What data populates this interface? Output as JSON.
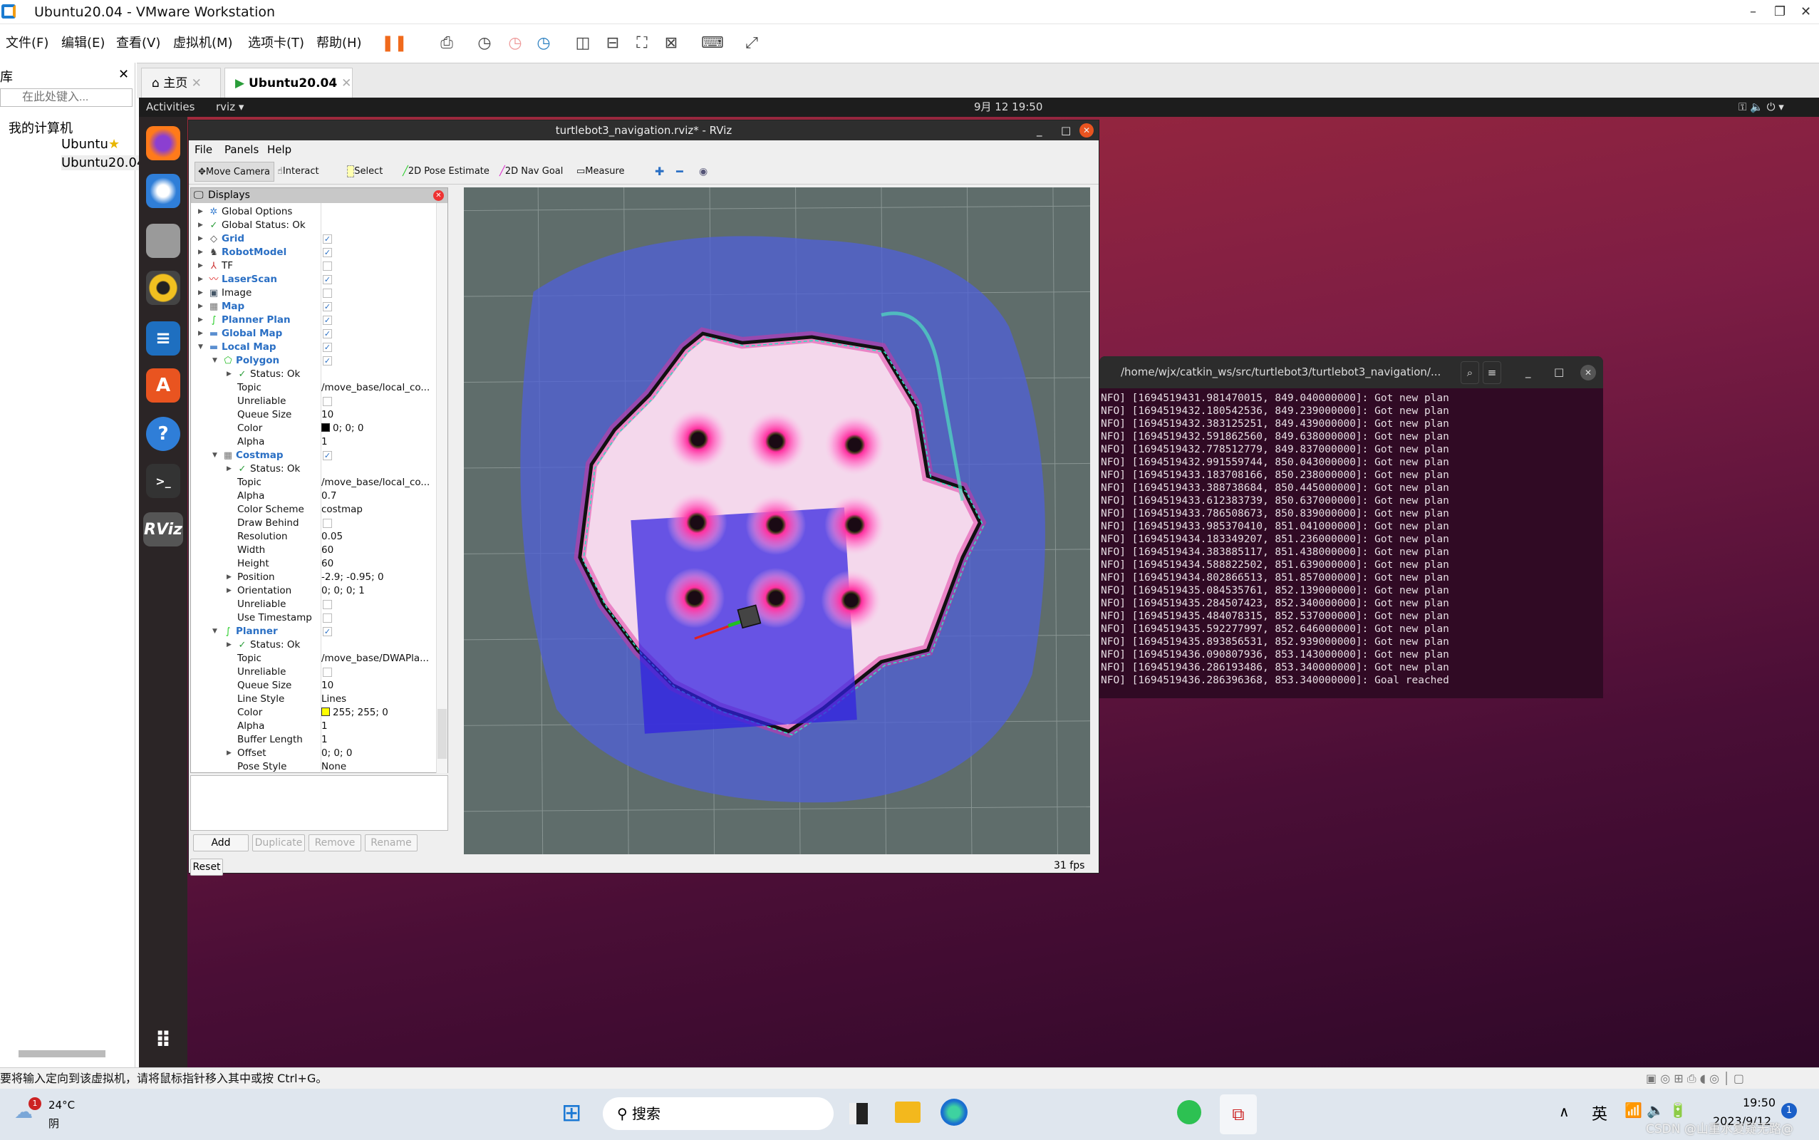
{
  "vmware": {
    "title": "Ubuntu20.04 - VMware Workstation",
    "menu": [
      "文件(F)",
      "编辑(E)",
      "查看(V)",
      "虚拟机(M)",
      "选项卡(T)",
      "帮助(H)"
    ],
    "library": {
      "title": "库",
      "search_placeholder": "在此处键入...",
      "tree": [
        "我的计算机",
        "Ubuntu",
        "Ubuntu20.04"
      ]
    },
    "tabs": [
      {
        "label": "主页",
        "icon": "home-icon"
      },
      {
        "label": "Ubuntu20.04",
        "icon": "vm-icon",
        "active": true
      }
    ],
    "status_text": "要将输入定向到该虚拟机，请将鼠标指针移入其中或按 Ctrl+G。"
  },
  "ubuntu": {
    "activities": "Activities",
    "app_menu": "rviz",
    "clock": "9月 12  19:50",
    "dock": [
      "firefox-icon",
      "thunderbird-icon",
      "files-icon",
      "rhythmbox-icon",
      "writer-icon",
      "software-icon",
      "help-icon",
      "terminal-icon",
      "rviz-icon"
    ],
    "rviz_dock_label": "RViz"
  },
  "rviz": {
    "title": "turtlebot3_navigation.rviz* - RViz",
    "menu": [
      "File",
      "Panels",
      "Help"
    ],
    "tools": [
      {
        "label": "Move Camera",
        "active": true
      },
      {
        "label": "Interact"
      },
      {
        "label": "Select"
      },
      {
        "label": "2D Pose Estimate"
      },
      {
        "label": "2D Nav Goal"
      },
      {
        "label": "Measure"
      }
    ],
    "panel_title": "Displays",
    "tree": [
      {
        "label": "Global Options",
        "level": 0,
        "exp": "closed",
        "icon": "gear"
      },
      {
        "label": "Global Status: Ok",
        "level": 0,
        "exp": "closed",
        "icon": "check"
      },
      {
        "label": "Grid",
        "level": 0,
        "exp": "closed",
        "icon": "grid",
        "bold": true,
        "check": true
      },
      {
        "label": "RobotModel",
        "level": 0,
        "exp": "closed",
        "icon": "robot",
        "bold": true,
        "check": true
      },
      {
        "label": "TF",
        "level": 0,
        "exp": "closed",
        "icon": "tf",
        "check": false
      },
      {
        "label": "LaserScan",
        "level": 0,
        "exp": "closed",
        "icon": "laser",
        "bold": true,
        "check": true
      },
      {
        "label": "Image",
        "level": 0,
        "exp": "closed",
        "icon": "image",
        "check": false
      },
      {
        "label": "Map",
        "level": 0,
        "exp": "closed",
        "icon": "map",
        "bold": true,
        "check": true
      },
      {
        "label": "Planner Plan",
        "level": 0,
        "exp": "closed",
        "icon": "path",
        "bold": true,
        "check": true
      },
      {
        "label": "Global Map",
        "level": 0,
        "exp": "closed",
        "icon": "folder",
        "bold": true,
        "check": true
      },
      {
        "label": "Local Map",
        "level": 0,
        "exp": "open",
        "icon": "folder",
        "bold": true,
        "check": true
      },
      {
        "label": "Polygon",
        "level": 1,
        "exp": "open",
        "icon": "polygon",
        "bold": true,
        "check": true
      },
      {
        "label": "Status: Ok",
        "level": 2,
        "exp": "closed",
        "icon": "check"
      },
      {
        "label": "Topic",
        "level": 3,
        "value": "/move_base/local_co..."
      },
      {
        "label": "Unreliable",
        "level": 3,
        "check": false
      },
      {
        "label": "Queue Size",
        "level": 3,
        "value": "10"
      },
      {
        "label": "Color",
        "level": 3,
        "value": "0; 0; 0",
        "swatch": "#000000"
      },
      {
        "label": "Alpha",
        "level": 3,
        "value": "1"
      },
      {
        "label": "Costmap",
        "level": 1,
        "exp": "open",
        "icon": "map",
        "bold": true,
        "check": true
      },
      {
        "label": "Status: Ok",
        "level": 2,
        "exp": "closed",
        "icon": "check"
      },
      {
        "label": "Topic",
        "level": 3,
        "value": "/move_base/local_co..."
      },
      {
        "label": "Alpha",
        "level": 3,
        "value": "0.7"
      },
      {
        "label": "Color Scheme",
        "level": 3,
        "value": "costmap"
      },
      {
        "label": "Draw Behind",
        "level": 3,
        "check": false
      },
      {
        "label": "Resolution",
        "level": 3,
        "value": "0.05"
      },
      {
        "label": "Width",
        "level": 3,
        "value": "60"
      },
      {
        "label": "Height",
        "level": 3,
        "value": "60"
      },
      {
        "label": "Position",
        "level": 3,
        "exp": "closed",
        "value": "-2.9; -0.95; 0"
      },
      {
        "label": "Orientation",
        "level": 3,
        "exp": "closed",
        "value": "0; 0; 0; 1"
      },
      {
        "label": "Unreliable",
        "level": 3,
        "check": false
      },
      {
        "label": "Use Timestamp",
        "level": 3,
        "check": false
      },
      {
        "label": "Planner",
        "level": 1,
        "exp": "open",
        "icon": "path",
        "bold": true,
        "check": true
      },
      {
        "label": "Status: Ok",
        "level": 2,
        "exp": "closed",
        "icon": "check"
      },
      {
        "label": "Topic",
        "level": 3,
        "value": "/move_base/DWAPla..."
      },
      {
        "label": "Unreliable",
        "level": 3,
        "check": false
      },
      {
        "label": "Queue Size",
        "level": 3,
        "value": "10"
      },
      {
        "label": "Line Style",
        "level": 3,
        "value": "Lines"
      },
      {
        "label": "Color",
        "level": 3,
        "value": "255; 255; 0",
        "swatch": "#ffff00"
      },
      {
        "label": "Alpha",
        "level": 3,
        "value": "1"
      },
      {
        "label": "Buffer Length",
        "level": 3,
        "value": "1"
      },
      {
        "label": "Offset",
        "level": 3,
        "exp": "closed",
        "value": "0; 0; 0"
      },
      {
        "label": "Pose Style",
        "level": 3,
        "value": "None"
      }
    ],
    "buttons": {
      "add": "Add",
      "duplicate": "Duplicate",
      "remove": "Remove",
      "rename": "Rename",
      "reset": "Reset"
    },
    "fps": "31 fps"
  },
  "terminal": {
    "title": "/home/wjx/catkin_ws/src/turtlebot3/turtlebot3_navigation/...",
    "lines": [
      "NFO] [1694519431.981470015, 849.040000000]: Got new plan",
      "NFO] [1694519432.180542536, 849.239000000]: Got new plan",
      "NFO] [1694519432.383125251, 849.439000000]: Got new plan",
      "NFO] [1694519432.591862560, 849.638000000]: Got new plan",
      "NFO] [1694519432.778512779, 849.837000000]: Got new plan",
      "NFO] [1694519432.991559744, 850.043000000]: Got new plan",
      "NFO] [1694519433.183708166, 850.238000000]: Got new plan",
      "NFO] [1694519433.388738684, 850.445000000]: Got new plan",
      "NFO] [1694519433.612383739, 850.637000000]: Got new plan",
      "NFO] [1694519433.786508673, 850.839000000]: Got new plan",
      "NFO] [1694519433.985370410, 851.041000000]: Got new plan",
      "NFO] [1694519434.183349207, 851.236000000]: Got new plan",
      "NFO] [1694519434.383885117, 851.438000000]: Got new plan",
      "NFO] [1694519434.588822502, 851.639000000]: Got new plan",
      "NFO] [1694519434.802866513, 851.857000000]: Got new plan",
      "NFO] [1694519435.084535761, 852.139000000]: Got new plan",
      "NFO] [1694519435.284507423, 852.340000000]: Got new plan",
      "NFO] [1694519435.484078315, 852.537000000]: Got new plan",
      "NFO] [1694519435.592277997, 852.646000000]: Got new plan",
      "NFO] [1694519435.893856531, 852.939000000]: Got new plan",
      "NFO] [1694519436.090807936, 853.143000000]: Got new plan",
      "NFO] [1694519436.286193486, 853.340000000]: Got new plan",
      "NFO] [1694519436.286396368, 853.340000000]: Goal reached"
    ]
  },
  "taskbar": {
    "weather_temp": "24°C",
    "weather_desc": "阴",
    "weather_badge": "1",
    "search": "搜索",
    "ime": "英",
    "time": "19:50",
    "date": "2023/9/12",
    "notif": "1",
    "watermark": "CSDN @山重水复疑无路@"
  }
}
